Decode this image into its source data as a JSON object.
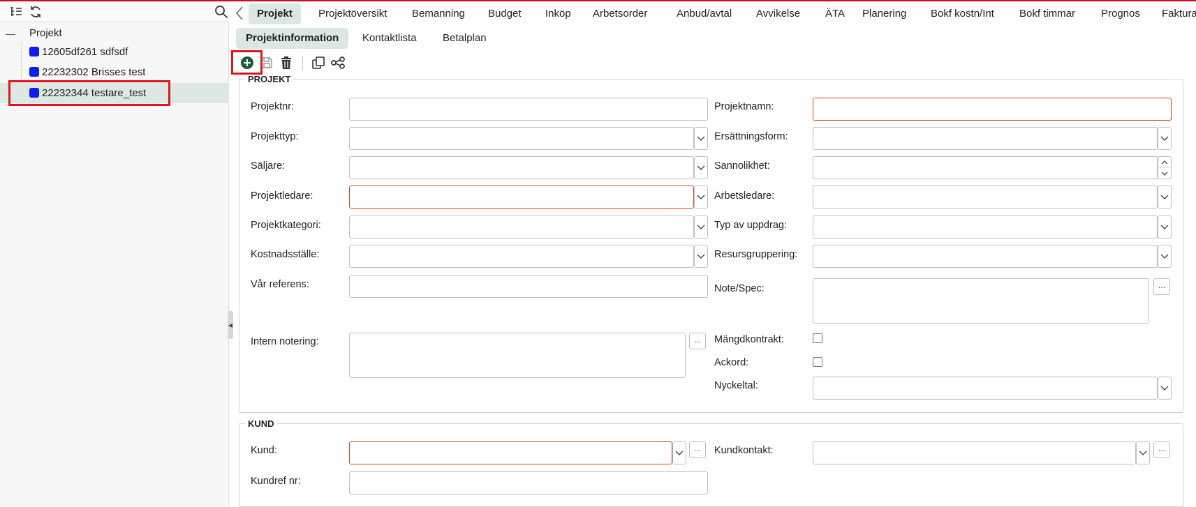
{
  "colors": {
    "accent_red": "#c0121d",
    "selection_bg": "#dce6e3",
    "project_marker": "#0a1ef0",
    "required_border": "#d9411e",
    "add_button": "#1d5b3c"
  },
  "sidebar": {
    "icons": [
      "tree-list-icon",
      "refresh-icon",
      "search-icon"
    ],
    "root": {
      "toggle": "—",
      "label": "Projekt"
    },
    "items": [
      {
        "label": "12605df261 sdfsdf"
      },
      {
        "label": "22232302 Brisses test"
      },
      {
        "label": "22232344 testare_test"
      }
    ]
  },
  "tabs": [
    "Projekt",
    "Projektöversikt",
    "Bemanning",
    "Budget",
    "Inköp",
    "Arbetsorder",
    "Anbud/avtal",
    "Avvikelse",
    "ÄTA",
    "Planering",
    "Bokf kostn/Int",
    "Bokf timmar",
    "Prognos",
    "Faktura"
  ],
  "subtabs": [
    "Projektinformation",
    "Kontaktlista",
    "Betalplan"
  ],
  "toolbar": [
    "add-icon",
    "save-icon",
    "delete-icon",
    "copy-icon",
    "share-icon"
  ],
  "projekt_section": {
    "legend": "PROJEKT",
    "left_fields": [
      "Projektnr:",
      "Projekttyp:",
      "Säljare:",
      "Projektledare:",
      "Projektkategori:",
      "Kostnadsställe:",
      "Vår referens:",
      "Intern notering:"
    ],
    "right_fields": [
      "Projektnamn:",
      "Ersättningsform:",
      "Sannolikhet:",
      "Arbetsledare:",
      "Typ av uppdrag:",
      "Resursgruppering:",
      "Note/Spec:",
      "Mängdkontrakt:",
      "Ackord:",
      "Nyckeltal:"
    ]
  },
  "kund_section": {
    "legend": "KUND",
    "fields": [
      "Kund:",
      "Kundkontakt:",
      "Kundref nr:"
    ]
  },
  "more_label": "..."
}
